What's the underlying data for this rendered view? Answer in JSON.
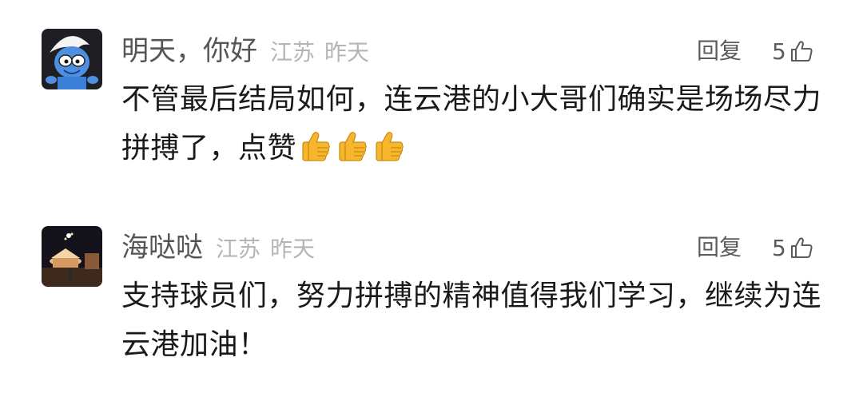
{
  "comments": [
    {
      "username": "明天，你好",
      "location": "江苏",
      "time": "昨天",
      "reply_label": "回复",
      "like_count": "5",
      "text": "不管最后结局如何，连云港的小大哥们确实是场场尽力拼搏了，点赞",
      "emoji_name": "thumbs-up-emoji",
      "emoji_count": 3,
      "avatar": "smurf-avatar"
    },
    {
      "username": "海哒哒",
      "location": "江苏",
      "time": "昨天",
      "reply_label": "回复",
      "like_count": "5",
      "text": "支持球员们，努力拼搏的精神值得我们学习，继续为连云港加油！",
      "avatar": "night-carousel-avatar"
    }
  ],
  "colors": {
    "name": "#555555",
    "meta": "#b5b5b5",
    "text": "#1a1a1a",
    "emoji": "#f6b72c"
  }
}
